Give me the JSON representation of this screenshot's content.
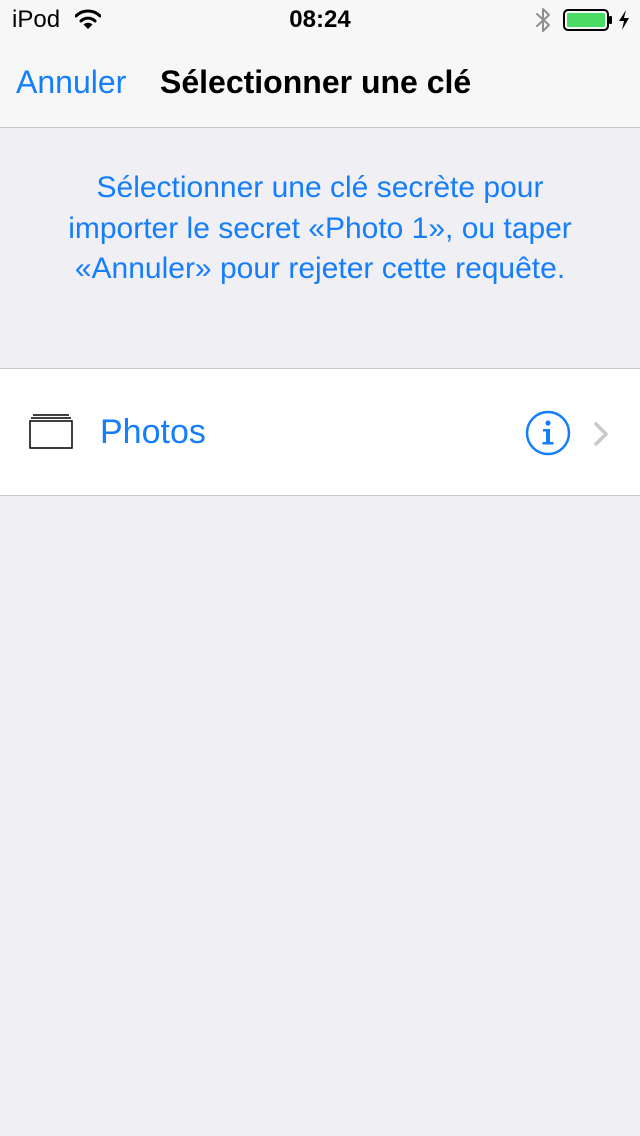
{
  "status_bar": {
    "carrier": "iPod",
    "time": "08:24",
    "wifi_icon": "wifi-icon",
    "bluetooth_icon": "bluetooth-icon",
    "battery_icon": "battery-icon",
    "battery_level": 1.0,
    "battery_color": "#4cd964",
    "charging_icon": "charging-bolt-icon"
  },
  "nav": {
    "cancel_label": "Annuler",
    "title": "Sélectionner une clé"
  },
  "message": "Sélectionner une clé secrète pour importer le secret «Photo 1», ou taper «Annuler» pour rejeter cette requête.",
  "list": {
    "items": [
      {
        "icon": "folder-icon",
        "label": "Photos",
        "info_icon": "info-icon",
        "chevron_icon": "chevron-right-icon"
      }
    ]
  },
  "colors": {
    "accent": "#157efb",
    "background": "#efeff4",
    "separator": "#c8c7cc",
    "navbar": "#f7f7f7"
  }
}
